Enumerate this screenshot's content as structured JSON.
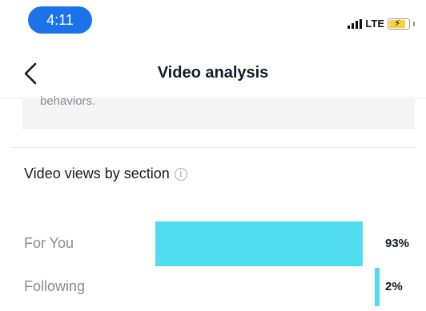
{
  "status_bar": {
    "time": "4:11",
    "network": "LTE",
    "icons": [
      "signal-bars-icon",
      "battery-charging-icon"
    ]
  },
  "nav": {
    "back_icon": "chevron-left-icon",
    "title": "Video analysis"
  },
  "info_card": {
    "text": "behaviors."
  },
  "section": {
    "title": "Video views by section",
    "info_icon": "info-circle-icon"
  },
  "chart_data": {
    "type": "bar",
    "orientation": "horizontal",
    "categories": [
      "For You",
      "Following"
    ],
    "values": [
      93,
      2
    ],
    "value_labels": [
      "93%",
      "2%"
    ],
    "unit": "%",
    "xlim": [
      0,
      100
    ],
    "bar_color": "#4fdcee"
  },
  "colors": {
    "accent": "#1a73e8",
    "bar": "#4fdcee",
    "text": "#161823",
    "muted": "#8a8b91"
  }
}
